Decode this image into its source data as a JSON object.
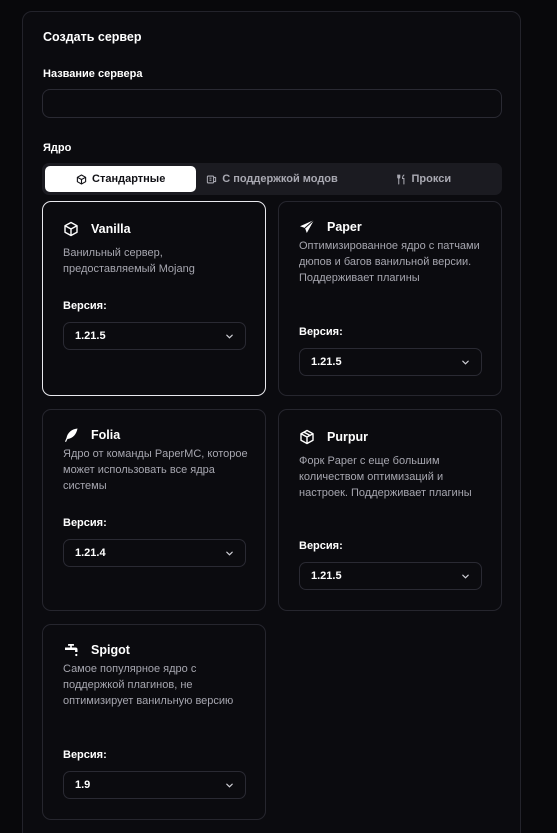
{
  "form": {
    "title": "Создать сервер",
    "name_label": "Название сервера",
    "name_value": "",
    "name_placeholder": "",
    "core_label": "Ядро"
  },
  "tabs": [
    {
      "label": "Стандартные",
      "icon": "cube-icon",
      "active": true
    },
    {
      "label": "С поддержкой модов",
      "icon": "mods-icon",
      "active": false
    },
    {
      "label": "Прокси",
      "icon": "proxy-icon",
      "active": false
    }
  ],
  "cores": [
    {
      "name": "Vanilla",
      "icon": "cube-icon",
      "desc": "Ванильный сервер, предоставляемый Mojang",
      "version_label": "Версия:",
      "version": "1.21.5",
      "selected": true
    },
    {
      "name": "Paper",
      "icon": "paper-plane-icon",
      "desc": "Оптимизированное ядро с патчами дюпов и багов ванильной версии. Поддерживает плагины",
      "version_label": "Версия:",
      "version": "1.21.5",
      "selected": false
    },
    {
      "name": "Folia",
      "icon": "feather-icon",
      "desc": "Ядро от команды PaperMC, которое может использовать все ядра системы",
      "version_label": "Версия:",
      "version": "1.21.4",
      "selected": false
    },
    {
      "name": "Purpur",
      "icon": "box-icon",
      "desc": "Форк Paper с еще большим количеством оптимизаций и настроек. Поддерживает плагины",
      "version_label": "Версия:",
      "version": "1.21.5",
      "selected": false
    },
    {
      "name": "Spigot",
      "icon": "faucet-icon",
      "desc": "Самое популярное ядро с поддержкой плагинов, не оптимизирует ванильную версию",
      "version_label": "Версия:",
      "version": "1.9",
      "selected": false
    }
  ],
  "colors": {
    "background": "#08080b",
    "panel": "#0b0b0f",
    "border": "#26262e",
    "selected_border": "#e9e9ee",
    "muted_text": "#a6a6af",
    "tab_bar": "#1b1b21"
  }
}
